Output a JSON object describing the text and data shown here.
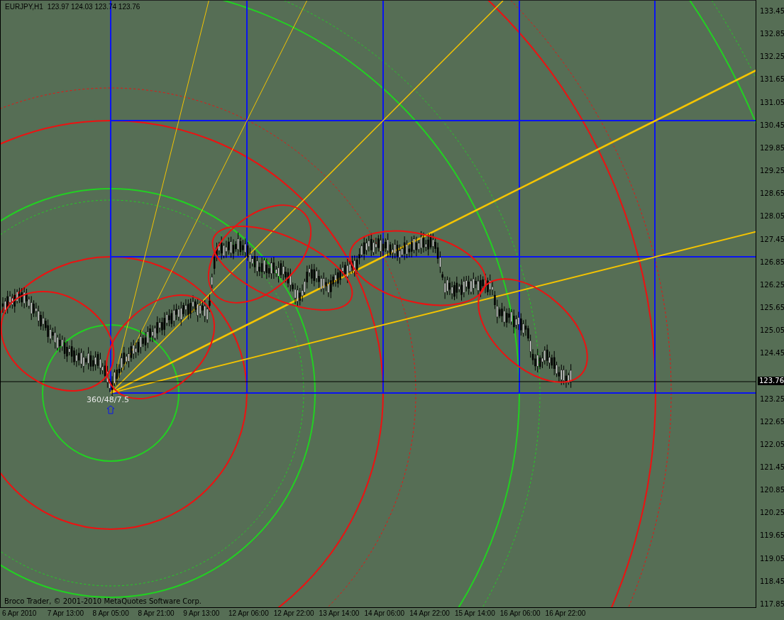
{
  "header": {
    "symbol": "EURJPY,H1",
    "quote": "123.97 124.03 123.74 123.76"
  },
  "annotation": "360/48/7.5",
  "footer": "Broco Trader, © 2001-2010 MetaQuotes Software Corp.",
  "price_axis": {
    "labels_upper": [
      "133.45",
      "132.85",
      "132.25",
      "131.65",
      "131.05",
      "130.45",
      "129.85",
      "129.25",
      "128.65",
      "128.05",
      "127.45",
      "126.85",
      "126.25",
      "125.65",
      "125.05",
      "124.45"
    ],
    "labels_lower": [
      "123.25",
      "122.65",
      "122.05",
      "121.45",
      "120.85",
      "120.25",
      "119.65",
      "119.05",
      "118.45",
      "117.85"
    ],
    "current_price": "123.76"
  },
  "time_axis": {
    "labels": [
      "6 Apr 2010",
      "7 Apr 13:00",
      "8 Apr 05:00",
      "8 Apr 21:00",
      "9 Apr 13:00",
      "12 Apr 06:00",
      "12 Apr 22:00",
      "13 Apr 14:00",
      "14 Apr 06:00",
      "14 Apr 22:00",
      "15 Apr 14:00",
      "16 Apr 06:00",
      "16 Apr 22:00"
    ]
  }
}
